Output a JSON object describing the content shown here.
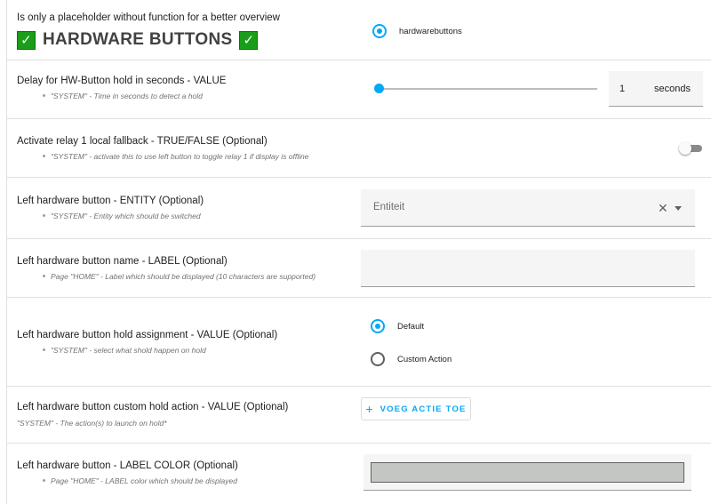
{
  "rows": [
    {
      "title": "Is only a placeholder without function for a better overview",
      "heading": "HARDWARE BUTTONS",
      "check_icon": "white-check-mark-emoji",
      "radio_options": [
        {
          "label": "hardwarebuttons",
          "selected": true
        }
      ]
    },
    {
      "title": "Delay for HW-Button hold in seconds - VALUE",
      "description": "\"SYSTEM\" - Time in seconds to detect a hold",
      "slider_value": 1,
      "input_value": "1",
      "unit": "seconds"
    },
    {
      "title": "Activate relay 1 local fallback - TRUE/FALSE (Optional)",
      "description": "\"SYSTEM\" - activate this to use left button to toggle relay 1 if display is offline",
      "toggle_on": false
    },
    {
      "title": "Left hardware button - ENTITY (Optional)",
      "description": "\"SYSTEM\" - Entity which should be switched",
      "placeholder": "Entiteit",
      "clear_icon": "close-icon",
      "dropdown_icon": "arrow-drop-down-icon"
    },
    {
      "title": "Left hardware button name - LABEL (Optional)",
      "description": "Page \"HOME\" - Label which should be displayed (10 characters are supported)",
      "input_value": ""
    },
    {
      "title": "Left hardware button hold assignment - VALUE (Optional)",
      "description": "\"SYSTEM\" - select what shold happen on hold",
      "radio_options": [
        {
          "label": "Default",
          "selected": true
        },
        {
          "label": "Custom Action",
          "selected": false
        }
      ]
    },
    {
      "title": "Left hardware button custom hold action - VALUE (Optional)",
      "description": "\"SYSTEM\" - The action(s) to launch on hold*",
      "button_icon": "+",
      "button_label": "VOEG ACTIE TOE"
    },
    {
      "title": "Left hardware button - LABEL COLOR (Optional)",
      "description": "Page \"HOME\" - LABEL color which should be displayed",
      "color_value": "#c4c6c3"
    }
  ],
  "colors": {
    "accent": "#03a9f4",
    "check_green": "#1a9e1a"
  }
}
